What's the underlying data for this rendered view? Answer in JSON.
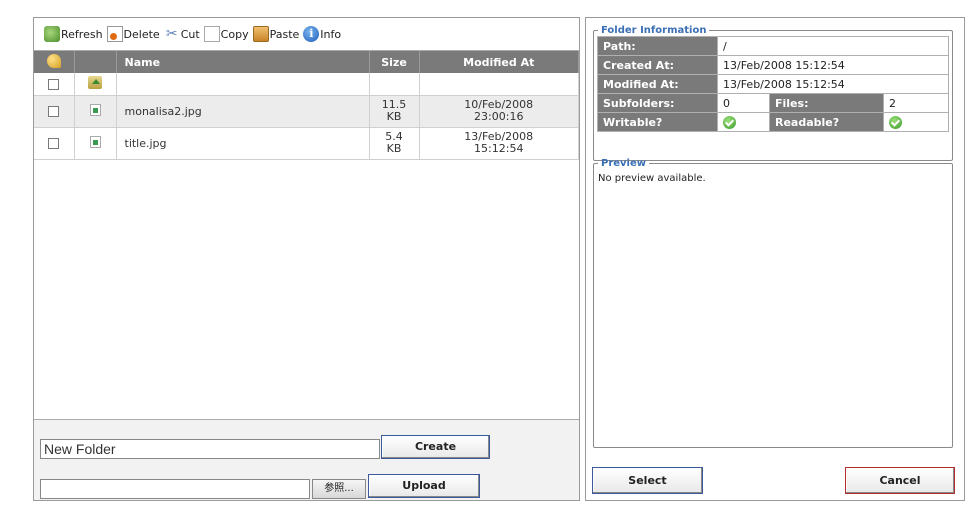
{
  "toolbar": {
    "refresh_label": "Refresh",
    "delete_label": "Delete",
    "cut_label": "Cut",
    "copy_label": "Copy",
    "paste_label": "Paste",
    "info_label": "Info",
    "icons": [
      "refresh-icon",
      "delete-icon",
      "cut-icon",
      "copy-icon",
      "paste-icon",
      "info-icon"
    ]
  },
  "file_table": {
    "columns": [
      "",
      "",
      "Name",
      "Size",
      "Modified At"
    ],
    "rows": [
      {
        "name": "",
        "size_value": "",
        "size_unit": "",
        "date": "",
        "time": "",
        "icon": "folder-up-icon"
      },
      {
        "name": "monalisa2.jpg",
        "size_value": "11.5",
        "size_unit": "KB",
        "date": "10/Feb/2008",
        "time": "23:00:16",
        "icon": "image-file-icon"
      },
      {
        "name": "title.jpg",
        "size_value": "5.4",
        "size_unit": "KB",
        "date": "13/Feb/2008",
        "time": "15:12:54",
        "icon": "image-file-icon"
      }
    ]
  },
  "new_folder": {
    "value": "New Folder",
    "create_label": "Create"
  },
  "upload": {
    "file_value": "",
    "browse_label": "参照...",
    "upload_label": "Upload"
  },
  "folder_info": {
    "legend": "Folder Information",
    "path_label": "Path:",
    "path_value": "/",
    "created_label": "Created At:",
    "created_value": "13/Feb/2008 15:12:54",
    "modified_label": "Modified At:",
    "modified_value": "13/Feb/2008 15:12:54",
    "subfolders_label": "Subfolders:",
    "subfolders_value": "0",
    "files_label": "Files:",
    "files_value": "2",
    "writable_label": "Writable?",
    "readable_label": "Readable?"
  },
  "preview": {
    "legend": "Preview",
    "text": "No preview available."
  },
  "actions": {
    "select_label": "Select",
    "cancel_label": "Cancel"
  }
}
